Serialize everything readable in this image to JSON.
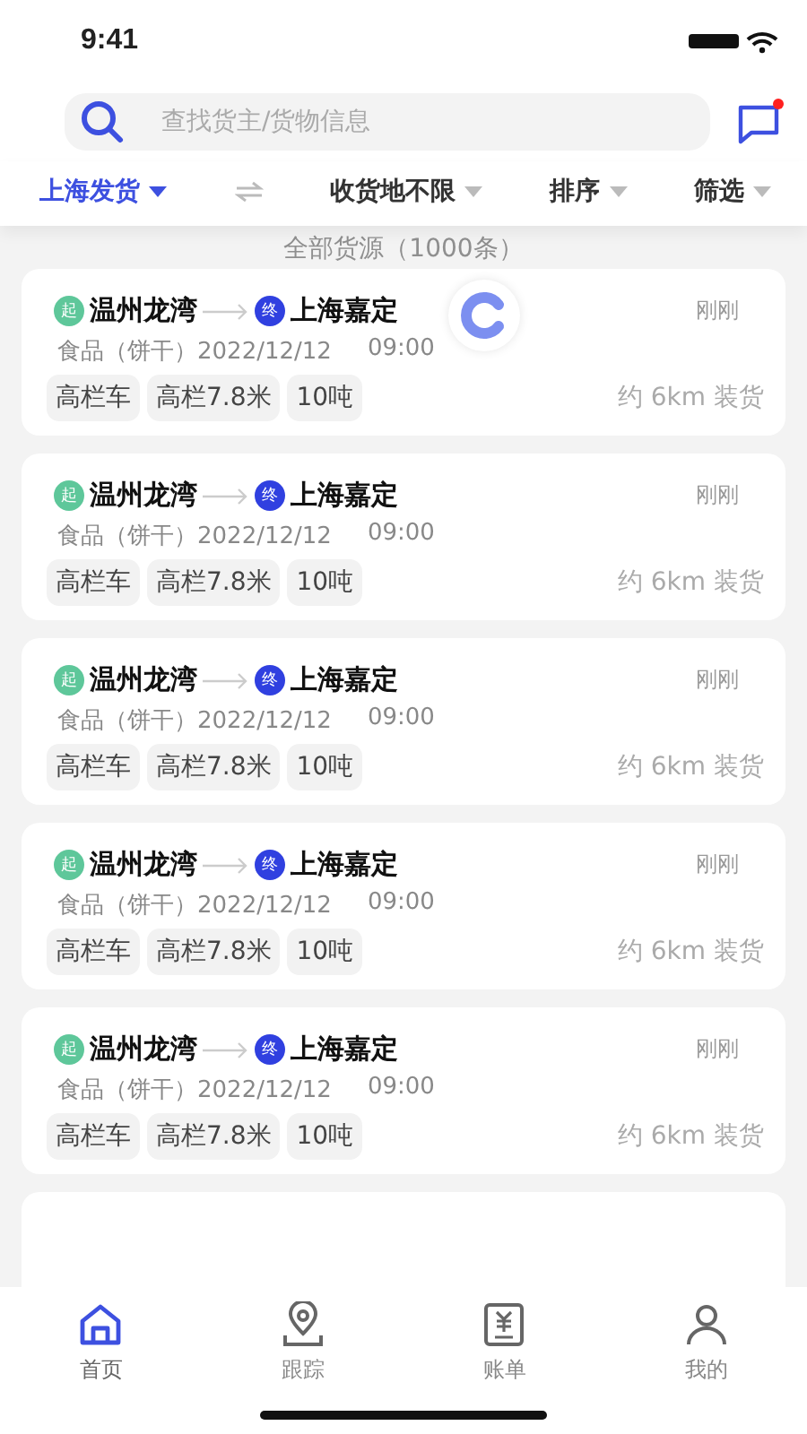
{
  "status_bar": {
    "time": "9:41"
  },
  "search": {
    "placeholder": "查找货主/货物信息",
    "message_unread": true
  },
  "filters": [
    {
      "label": "上海发货",
      "selected": true,
      "swap": true
    },
    {
      "label": "收货地不限",
      "selected": false,
      "swap": false
    },
    {
      "label": "排序",
      "selected": false,
      "swap": false
    },
    {
      "label": "筛选",
      "selected": false,
      "swap": false
    }
  ],
  "summary": "全部货源（1000条）",
  "loading": true,
  "cards": [
    {
      "origin_badge": "起",
      "origin": "温州龙湾",
      "dest_badge": "终",
      "destination": "上海嘉定",
      "time_ago": "刚刚",
      "cargo": "食品（饼干）2022/12/12",
      "time": "09:00",
      "tags": [
        "高栏车",
        "高栏7.8米",
        "10吨"
      ],
      "distance": "约 6km 装货"
    },
    {
      "origin_badge": "起",
      "origin": "温州龙湾",
      "dest_badge": "终",
      "destination": "上海嘉定",
      "time_ago": "刚刚",
      "cargo": "食品（饼干）2022/12/12",
      "time": "09:00",
      "tags": [
        "高栏车",
        "高栏7.8米",
        "10吨"
      ],
      "distance": "约 6km 装货"
    },
    {
      "origin_badge": "起",
      "origin": "温州龙湾",
      "dest_badge": "终",
      "destination": "上海嘉定",
      "time_ago": "刚刚",
      "cargo": "食品（饼干）2022/12/12",
      "time": "09:00",
      "tags": [
        "高栏车",
        "高栏7.8米",
        "10吨"
      ],
      "distance": "约 6km 装货"
    },
    {
      "origin_badge": "起",
      "origin": "温州龙湾",
      "dest_badge": "终",
      "destination": "上海嘉定",
      "time_ago": "刚刚",
      "cargo": "食品（饼干）2022/12/12",
      "time": "09:00",
      "tags": [
        "高栏车",
        "高栏7.8米",
        "10吨"
      ],
      "distance": "约 6km 装货"
    },
    {
      "origin_badge": "起",
      "origin": "温州龙湾",
      "dest_badge": "终",
      "destination": "上海嘉定",
      "time_ago": "刚刚",
      "cargo": "食品（饼干）2022/12/12",
      "time": "09:00",
      "tags": [
        "高栏车",
        "高栏7.8米",
        "10吨"
      ],
      "distance": "约 6km 装货"
    }
  ],
  "tab_bar": [
    {
      "label": "首页",
      "selected": true
    },
    {
      "label": "跟踪",
      "selected": false
    },
    {
      "label": "账单",
      "selected": false
    },
    {
      "label": "我的",
      "selected": false
    }
  ]
}
